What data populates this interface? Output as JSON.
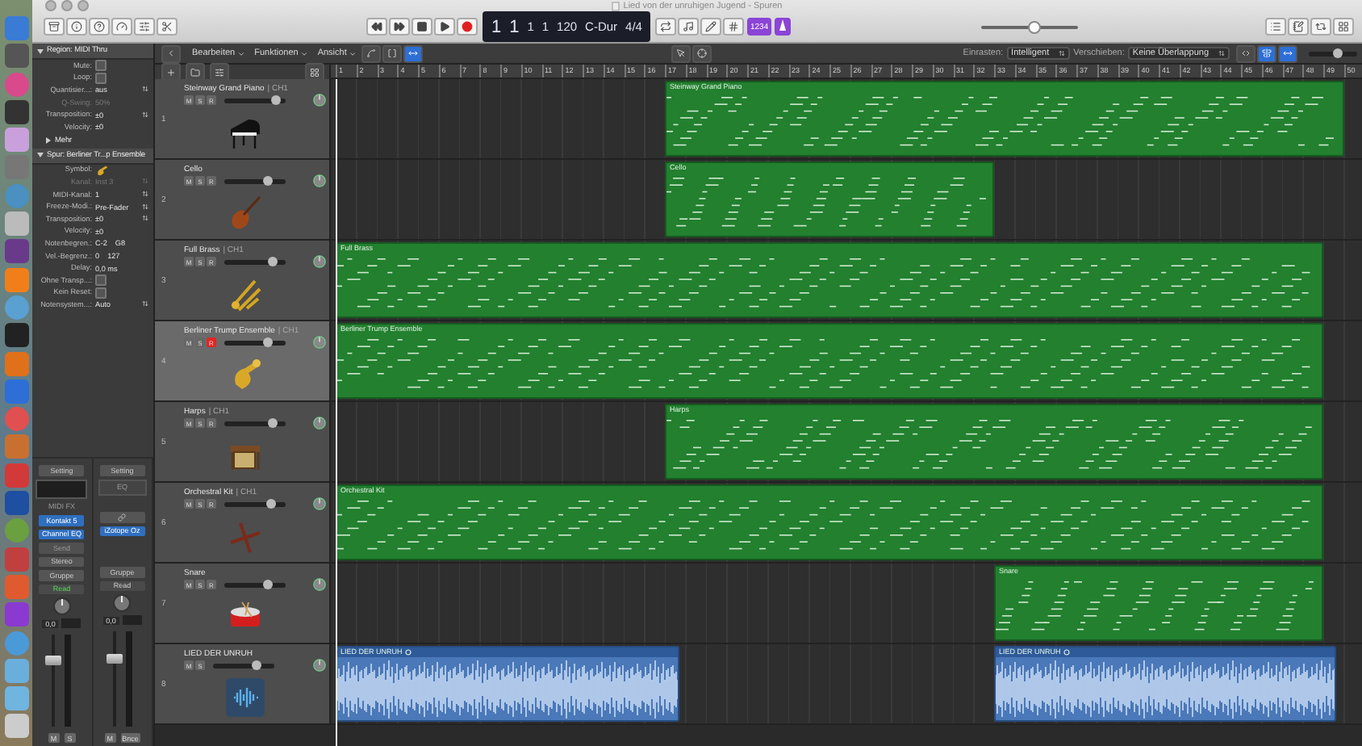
{
  "window": {
    "title": "Lied von der unruhigen Jugend - Spuren"
  },
  "transport": {
    "lcd": [
      {
        "text": "1",
        "kind": "big"
      },
      {
        "text": "1",
        "kind": "big"
      },
      {
        "text": "1",
        "kind": "small"
      },
      {
        "text": "1",
        "kind": "small"
      },
      {
        "text": "120",
        "kind": "small"
      },
      {
        "text": "C-Dur",
        "kind": "small"
      },
      {
        "text": "4/4",
        "kind": "small"
      }
    ],
    "count_in": "1234",
    "master_volume": {
      "level": 0.55
    }
  },
  "toolbar": {
    "menus": [
      "Bearbeiten",
      "Funktionen",
      "Ansicht"
    ],
    "tools": [
      {
        "on": false
      },
      {
        "on": false
      },
      {
        "on": true
      }
    ],
    "snap_label": "Einrasten:",
    "snap_value": "Intelligent",
    "drag_label": "Verschieben:",
    "drag_value": "Keine Überlappung",
    "view_tools": [
      {
        "on": false
      },
      {
        "on": true
      },
      {
        "on": true
      }
    ],
    "zoom": {
      "level": 0.6
    }
  },
  "inspector": {
    "sections": [
      {
        "label": "Region:",
        "title": "MIDI Thru",
        "more": "Mehr",
        "rows": [
          {
            "label": "Mute:",
            "kind": "checkbox",
            "checked": false,
            "disabled": false
          },
          {
            "label": "Loop:",
            "kind": "checkbox",
            "checked": false,
            "disabled": false
          },
          {
            "label": "Quantisier...:",
            "kind": "popup",
            "value": "aus",
            "disabled": false
          },
          {
            "label": "Q-Swing:",
            "kind": "value",
            "value": "50%",
            "disabled": true
          },
          {
            "label": "Transposition:",
            "kind": "popup",
            "value": "±0",
            "disabled": false
          },
          {
            "label": "Velocity:",
            "kind": "value",
            "value": "±0",
            "disabled": false
          }
        ]
      },
      {
        "label": "Spur:",
        "title": "Berliner Tr...p Ensemble",
        "rows": [
          {
            "label": "Symbol:",
            "kind": "symbol",
            "disabled": false
          },
          {
            "label": "Kanal:",
            "kind": "popup",
            "value": "Inst 3",
            "disabled": true
          },
          {
            "label": "MIDI-Kanal:",
            "kind": "popup",
            "value": "1",
            "disabled": false
          },
          {
            "label": "Freeze-Modi.:",
            "kind": "popup",
            "value": "Pre-Fader",
            "disabled": false
          },
          {
            "label": "Transposition:",
            "kind": "popup",
            "value": "±0",
            "disabled": false
          },
          {
            "label": "Velocity:",
            "kind": "value",
            "value": "±0",
            "disabled": false
          },
          {
            "label": "Notenbegren.:",
            "kind": "range",
            "values": [
              "C-2",
              "G8"
            ],
            "disabled": false
          },
          {
            "label": "Vel.-Begrenz.:",
            "kind": "range",
            "values": [
              "0",
              "127"
            ],
            "disabled": false
          },
          {
            "label": "Delay:",
            "kind": "value",
            "value": "0,0 ms",
            "disabled": false
          },
          {
            "label": "Ohne Transp...:",
            "kind": "checkbox",
            "checked": false,
            "disabled": false
          },
          {
            "label": "Kein Reset:",
            "kind": "checkbox",
            "checked": false,
            "disabled": false
          },
          {
            "label": "Notensystem...:",
            "kind": "popup",
            "value": "Auto",
            "disabled": false
          }
        ]
      }
    ],
    "strips": [
      {
        "slots": [
          {
            "kind": "button",
            "text": "Setting"
          },
          {
            "kind": "eq_display"
          },
          {
            "kind": "label",
            "text": "MIDI FX"
          },
          {
            "kind": "insert",
            "text": "Kontakt 5"
          },
          {
            "kind": "insert",
            "text": "Channel EQ"
          },
          {
            "kind": "send",
            "text": "Send"
          },
          {
            "kind": "button",
            "text": "Stereo"
          },
          {
            "kind": "button",
            "text": "Gruppe"
          },
          {
            "kind": "automation",
            "text": "Read",
            "on": true
          },
          {
            "kind": "knob"
          },
          {
            "kind": "readout",
            "text": "0,0"
          },
          {
            "kind": "fader",
            "level": 0.72
          },
          {
            "kind": "buttons",
            "items": [
              "M",
              "S"
            ]
          }
        ]
      },
      {
        "slots": [
          {
            "kind": "button",
            "text": "Setting"
          },
          {
            "kind": "eq_box",
            "text": "EQ"
          },
          {
            "kind": "space"
          },
          {
            "kind": "link"
          },
          {
            "kind": "insert",
            "text": "iZotope Oz"
          },
          {
            "kind": "space"
          },
          {
            "kind": "space"
          },
          {
            "kind": "button",
            "text": "Gruppe"
          },
          {
            "kind": "automation",
            "text": "Read",
            "on": false
          },
          {
            "kind": "knob"
          },
          {
            "kind": "readout",
            "text": "0,0"
          },
          {
            "kind": "fader",
            "level": 0.72
          },
          {
            "kind": "buttons",
            "items": [
              "M",
              "Bnce"
            ]
          }
        ]
      }
    ]
  },
  "ruler": [
    "1",
    "2",
    "3",
    "4",
    "5",
    "6",
    "7",
    "8",
    "9",
    "10",
    "11",
    "12",
    "13",
    "14",
    "15",
    "16",
    "17",
    "18",
    "19",
    "20",
    "21",
    "22",
    "23",
    "24",
    "25",
    "26",
    "27",
    "28",
    "29",
    "30",
    "31",
    "32",
    "33",
    "34",
    "35",
    "36",
    "37",
    "38",
    "39",
    "40",
    "41",
    "42",
    "43",
    "44",
    "45",
    "46",
    "47",
    "48",
    "49",
    "50"
  ],
  "tracks": [
    {
      "number": "1",
      "name": "Steinway Grand Piano",
      "channel": "| CH1",
      "selected": false,
      "level": 0.85,
      "buttons": [
        {
          "label": "M",
          "kind": "mute",
          "on": false
        },
        {
          "label": "S",
          "kind": "solo",
          "on": false
        },
        {
          "label": "R",
          "kind": "record",
          "on": false
        }
      ],
      "regions": [
        {
          "kind": "midi",
          "name": "Steinway Grand Piano"
        }
      ]
    },
    {
      "number": "2",
      "name": "Cello",
      "selected": false,
      "level": 0.7,
      "buttons": [
        {
          "label": "M",
          "kind": "mute",
          "on": false
        },
        {
          "label": "S",
          "kind": "solo",
          "on": false
        },
        {
          "label": "R",
          "kind": "record",
          "on": false
        }
      ],
      "regions": [
        {
          "kind": "midi",
          "name": "Cello"
        }
      ]
    },
    {
      "number": "3",
      "name": "Full Brass",
      "channel": "| CH1",
      "selected": false,
      "level": 0.78,
      "buttons": [
        {
          "label": "M",
          "kind": "mute",
          "on": false
        },
        {
          "label": "S",
          "kind": "solo",
          "on": false
        },
        {
          "label": "R",
          "kind": "record",
          "on": false
        }
      ],
      "regions": [
        {
          "kind": "midi",
          "name": "Full Brass"
        }
      ]
    },
    {
      "number": "4",
      "name": "Berliner Trump Ensemble",
      "channel": "| CH1",
      "selected": true,
      "level": 0.72,
      "buttons": [
        {
          "label": "M",
          "kind": "mute",
          "on": false
        },
        {
          "label": "S",
          "kind": "solo",
          "on": false
        },
        {
          "label": "R",
          "kind": "record",
          "on": true
        }
      ],
      "regions": [
        {
          "kind": "midi",
          "name": "Berliner Trump Ensemble"
        }
      ]
    },
    {
      "number": "5",
      "name": "Harps",
      "channel": "| CH1",
      "selected": false,
      "level": 0.78,
      "buttons": [
        {
          "label": "M",
          "kind": "mute",
          "on": false
        },
        {
          "label": "S",
          "kind": "solo",
          "on": false
        },
        {
          "label": "R",
          "kind": "record",
          "on": false
        }
      ],
      "regions": [
        {
          "kind": "midi",
          "name": "Harps"
        }
      ]
    },
    {
      "number": "6",
      "name": "Orchestral Kit",
      "channel": "| CH1",
      "selected": false,
      "level": 0.77,
      "buttons": [
        {
          "label": "M",
          "kind": "mute",
          "on": false
        },
        {
          "label": "S",
          "kind": "solo",
          "on": false
        },
        {
          "label": "R",
          "kind": "record",
          "on": false
        }
      ],
      "regions": [
        {
          "kind": "midi",
          "name": "Orchestral Kit"
        }
      ]
    },
    {
      "number": "7",
      "name": "Snare",
      "selected": false,
      "level": 0.7,
      "buttons": [
        {
          "label": "M",
          "kind": "mute",
          "on": false
        },
        {
          "label": "S",
          "kind": "solo",
          "on": false
        },
        {
          "label": "R",
          "kind": "record",
          "on": false
        }
      ],
      "regions": [
        {
          "kind": "midi",
          "name": "Snare"
        }
      ]
    },
    {
      "number": "8",
      "name": "LIED DER UNRUH",
      "selected": false,
      "level": 0.7,
      "buttons": [
        {
          "label": "M",
          "kind": "mute",
          "on": false
        },
        {
          "label": "S",
          "kind": "solo",
          "on": false
        }
      ],
      "regions": [
        {
          "kind": "audio",
          "name": "LIED DER UNRUH"
        },
        {
          "kind": "audio",
          "name": "LIED DER UNRUH"
        }
      ]
    }
  ]
}
